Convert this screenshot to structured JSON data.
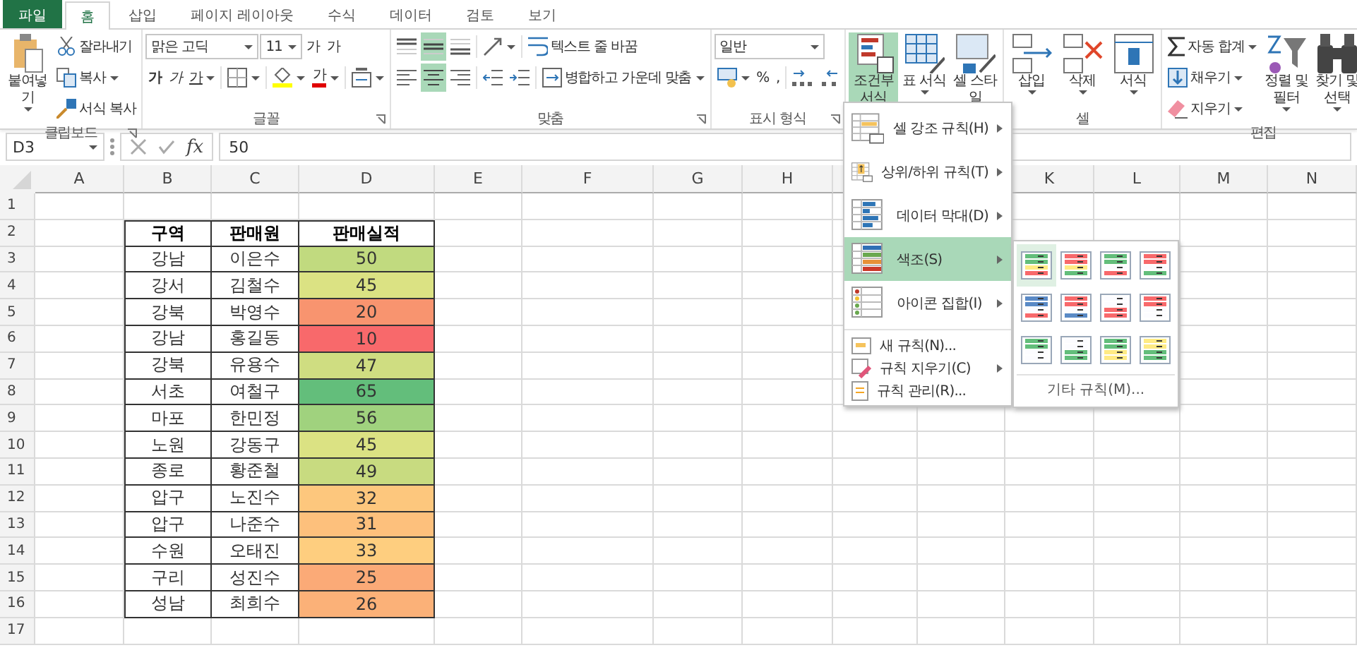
{
  "ribbon": {
    "tabs": [
      {
        "label": "파일",
        "kind": "file",
        "selected": false
      },
      {
        "label": "홈",
        "kind": "tab",
        "selected": true
      },
      {
        "label": "삽입",
        "kind": "tab",
        "selected": false
      },
      {
        "label": "페이지 레이아웃",
        "kind": "tab",
        "selected": false
      },
      {
        "label": "수식",
        "kind": "tab",
        "selected": false
      },
      {
        "label": "데이터",
        "kind": "tab",
        "selected": false
      },
      {
        "label": "검토",
        "kind": "tab",
        "selected": false
      },
      {
        "label": "보기",
        "kind": "tab",
        "selected": false
      }
    ],
    "groups": [
      {
        "label": "클립보드",
        "launcher": true,
        "columns": [
          {
            "kind": "large",
            "label": "붙여넣기",
            "dropdown": true
          },
          {
            "kind": "stack",
            "lines": [
              [
                {
                  "kind": "button",
                  "label": "잘라내기"
                }
              ],
              [
                {
                  "kind": "button",
                  "label": "복사",
                  "dropdown": true
                }
              ],
              [
                {
                  "kind": "button",
                  "label": "서식 복사"
                }
              ]
            ]
          }
        ]
      },
      {
        "label": "글꼴",
        "launcher": true,
        "columns": [
          {
            "kind": "stack",
            "lines": [
              [
                {
                  "kind": "font-field",
                  "value": "맑은 고딕"
                },
                {
                  "kind": "size-field",
                  "value": "11"
                },
                {
                  "kind": "glyph",
                  "label": "가"
                },
                {
                  "kind": "glyph",
                  "label": "가"
                }
              ],
              [
                {
                  "kind": "bold-glyph",
                  "label": "가"
                },
                {
                  "kind": "italic-glyph",
                  "label": "가"
                },
                {
                  "kind": "underline-glyph",
                  "label": "가",
                  "dropdown": true
                },
                {
                  "kind": "separator"
                },
                {
                  "kind": "icon",
                  "dropdown": true
                },
                {
                  "kind": "separator"
                },
                {
                  "kind": "icon",
                  "dropdown": true
                },
                {
                  "kind": "color-glyph",
                  "label": "가",
                  "dropdown": true
                },
                {
                  "kind": "separator"
                },
                {
                  "kind": "icon",
                  "dropdown": true
                }
              ]
            ]
          }
        ]
      },
      {
        "label": "맞춤",
        "launcher": true,
        "columns": [
          {
            "kind": "stack",
            "lines": [
              [
                {
                  "kind": "icon",
                  "on": false
                },
                {
                  "kind": "icon",
                  "on": true
                },
                {
                  "kind": "icon",
                  "on": false
                },
                {
                  "kind": "separator"
                },
                {
                  "kind": "icon",
                  "on": false,
                  "dropdown": true
                },
                {
                  "kind": "separator"
                },
                {
                  "kind": "button",
                  "label": "텍스트 줄 바꿈"
                }
              ],
              [
                {
                  "kind": "icon",
                  "on": false
                },
                {
                  "kind": "icon",
                  "on": true
                },
                {
                  "kind": "icon",
                  "on": false
                },
                {
                  "kind": "separator"
                },
                {
                  "kind": "icon",
                  "on": false
                },
                {
                  "kind": "icon",
                  "on": false
                },
                {
                  "kind": "separator"
                },
                {
                  "kind": "button",
                  "label": "병합하고 가운데 맞춤",
                  "dropdown": true
                }
              ]
            ]
          }
        ]
      },
      {
        "label": "표시 형식",
        "launcher": true,
        "columns": [
          {
            "kind": "stack",
            "lines": [
              [
                {
                  "kind": "number-field",
                  "value": "일반"
                }
              ],
              [
                {
                  "kind": "icon",
                  "dropdown": true
                },
                {
                  "kind": "glyph",
                  "label": "%"
                },
                {
                  "kind": "glyph",
                  "label": ","
                },
                {
                  "kind": "separator"
                },
                {
                  "kind": "icon"
                },
                {
                  "kind": "icon"
                }
              ]
            ]
          }
        ]
      },
      {
        "columns": [
          {
            "kind": "large",
            "label": "조건부 서식",
            "dropdown": true,
            "open": true
          },
          {
            "kind": "large",
            "label": "표 서식",
            "dropdown": true,
            "open": false
          },
          {
            "kind": "large",
            "label": "셀 스타일",
            "dropdown": true,
            "open": false
          }
        ]
      },
      {
        "label": "셀",
        "columns": [
          {
            "kind": "large",
            "label": "삽입",
            "dropdown": true
          },
          {
            "kind": "large",
            "label": "삭제",
            "dropdown": true
          },
          {
            "kind": "large",
            "label": "서식",
            "dropdown": true
          }
        ]
      },
      {
        "label": "편집",
        "columns": [
          {
            "kind": "stack",
            "lines": [
              [
                {
                  "kind": "button",
                  "label": "자동 합계",
                  "dropdown": true
                }
              ],
              [
                {
                  "kind": "button",
                  "label": "채우기",
                  "dropdown": true
                }
              ],
              [
                {
                  "kind": "button",
                  "label": "지우기",
                  "dropdown": true
                }
              ]
            ]
          },
          {
            "kind": "large",
            "label": "정렬 및 필터",
            "dropdown": true
          },
          {
            "kind": "large",
            "label": "찾기 및 선택",
            "dropdown": true
          }
        ]
      }
    ]
  },
  "formula_bar": {
    "name_box": "D3",
    "function_label": "fx",
    "value": "50"
  },
  "sheet": {
    "column_headers": [
      "A",
      "B",
      "C",
      "D",
      "E",
      "F",
      "G",
      "H",
      "K",
      "L",
      "M",
      "N"
    ],
    "row_headers": [
      "1",
      "2",
      "3",
      "4",
      "5",
      "6",
      "7",
      "8",
      "9",
      "10",
      "11",
      "12",
      "13",
      "14",
      "15",
      "16",
      "17"
    ],
    "table": {
      "columns": [
        "구역",
        "판매원",
        "판매실적"
      ],
      "rows": [
        {
          "region": "강남",
          "seller": "이은수",
          "sales": "50",
          "color": "#c1da7f"
        },
        {
          "region": "강서",
          "seller": "김철수",
          "sales": "45",
          "color": "#dbe283"
        },
        {
          "region": "강북",
          "seller": "박영수",
          "sales": "20",
          "color": "#f8946f"
        },
        {
          "region": "강남",
          "seller": "홍길동",
          "sales": "10",
          "color": "#f8696b"
        },
        {
          "region": "강북",
          "seller": "유용수",
          "sales": "47",
          "color": "#cfdd81"
        },
        {
          "region": "서초",
          "seller": "여철구",
          "sales": "65",
          "color": "#63be7b"
        },
        {
          "region": "마포",
          "seller": "한민정",
          "sales": "56",
          "color": "#a0d27e"
        },
        {
          "region": "노원",
          "seller": "강동구",
          "sales": "45",
          "color": "#dbe283"
        },
        {
          "region": "종로",
          "seller": "황준철",
          "sales": "49",
          "color": "#c8db80"
        },
        {
          "region": "압구",
          "seller": "노진수",
          "sales": "32",
          "color": "#fdc77d"
        },
        {
          "region": "압구",
          "seller": "나준수",
          "sales": "31",
          "color": "#fdc07c"
        },
        {
          "region": "수원",
          "seller": "오태진",
          "sales": "33",
          "color": "#fece7f"
        },
        {
          "region": "구리",
          "seller": "성진수",
          "sales": "25",
          "color": "#fbaa77"
        },
        {
          "region": "성남",
          "seller": "최희수",
          "sales": "26",
          "color": "#fbb178"
        }
      ]
    }
  },
  "format_menu": {
    "items": [
      {
        "label": "셀 강조 규칙(H)",
        "kind": "large",
        "submenu": true,
        "selected": false
      },
      {
        "label": "상위/하위 규칙(T)",
        "kind": "large",
        "submenu": true,
        "selected": false
      },
      {
        "label": "데이터 막대(D)",
        "kind": "large",
        "submenu": true,
        "selected": false
      },
      {
        "label": "색조(S)",
        "kind": "large",
        "submenu": true,
        "selected": true
      },
      {
        "label": "아이콘 집합(I)",
        "kind": "large",
        "submenu": true,
        "selected": false
      },
      {
        "label": "새 규칙(N)...",
        "kind": "small",
        "submenu": false,
        "selected": false
      },
      {
        "label": "규칙 지우기(C)",
        "kind": "small",
        "submenu": true,
        "selected": false
      },
      {
        "label": "규칙 관리(R)...",
        "kind": "small",
        "submenu": false,
        "selected": false
      }
    ],
    "submenu": {
      "swatches": [
        {
          "selected": true
        },
        {
          "selected": false
        },
        {
          "selected": false
        },
        {
          "selected": false
        },
        {
          "selected": false
        },
        {
          "selected": false
        },
        {
          "selected": false
        },
        {
          "selected": false
        },
        {
          "selected": false
        },
        {
          "selected": false
        },
        {
          "selected": false
        },
        {
          "selected": false
        }
      ],
      "footer": "기타 규칙(M)..."
    }
  }
}
